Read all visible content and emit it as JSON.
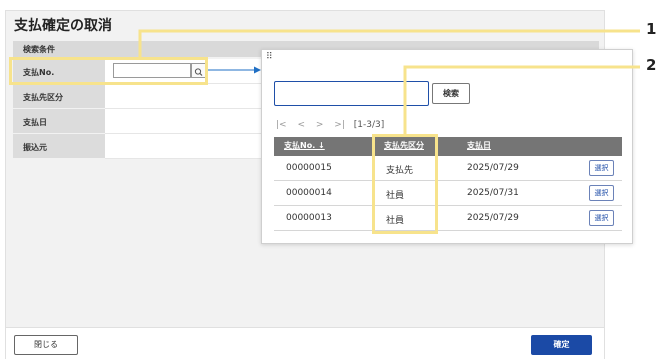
{
  "window": {
    "title": "支払確定の取消",
    "search_section": "検索条件",
    "fields": [
      {
        "label": "支払No."
      },
      {
        "label": "支払先区分"
      },
      {
        "label": "支払日"
      },
      {
        "label": "振込元"
      }
    ],
    "close_label": "閉じる",
    "confirm_label": "確定"
  },
  "popup": {
    "drag_handle": "⠿",
    "search_placeholder": "",
    "search_label": "検索",
    "pager": {
      "first": "|<",
      "prev": "<",
      "next": ">",
      "last": ">|",
      "count": "[1-3/3]"
    },
    "columns": [
      "支払No. ↓",
      "支払先区分",
      "支払日"
    ],
    "rows": [
      {
        "no": "00000015",
        "type": "支払先",
        "date": "2025/07/29",
        "action": "選択"
      },
      {
        "no": "00000014",
        "type": "社員",
        "date": "2025/07/31",
        "action": "選択"
      },
      {
        "no": "00000013",
        "type": "社員",
        "date": "2025/07/29",
        "action": "選択"
      }
    ]
  },
  "annotations": {
    "callout_1": "1",
    "callout_2": "2"
  },
  "colors": {
    "accent": "#1b4aa6",
    "highlight": "#f7e38c",
    "table_header": "#757575"
  },
  "icons": {
    "search_button": "magnifier-icon",
    "sort": "arrow-down-icon",
    "arrow": "arrow-right-icon"
  }
}
